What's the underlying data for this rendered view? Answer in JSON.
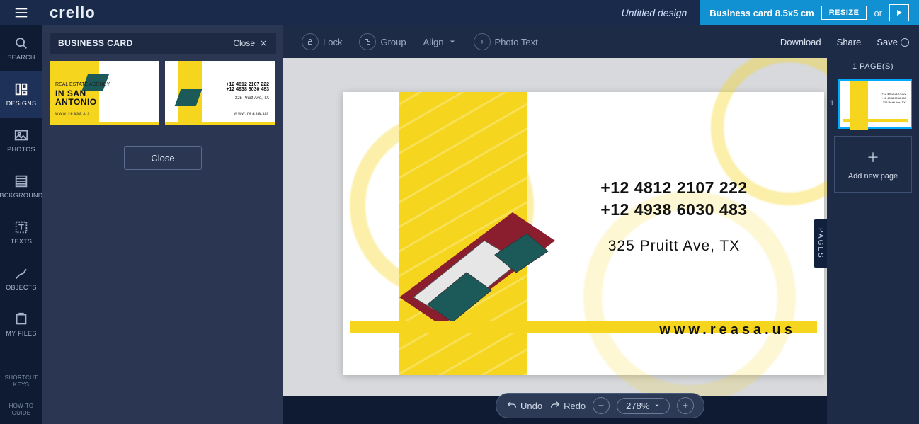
{
  "topbar": {
    "logo": "crello",
    "design_name": "Untitled design",
    "card_type": "Business card 8.5x5 cm",
    "resize": "RESIZE",
    "or": "or"
  },
  "rail": {
    "search": "SEARCH",
    "designs": "DESIGNS",
    "photos": "PHOTOS",
    "background": "BCKGROUND",
    "texts": "TEXTS",
    "objects": "OBJECTS",
    "myfiles": "MY FILES",
    "shortcut": "SHORTCUT KEYS",
    "howto": "HOW-TO GUIDE"
  },
  "sidepanel": {
    "title": "BUSINESS CARD",
    "close": "Close",
    "close_btn": "Close",
    "thumb1": {
      "line1": "REAL ESTATE AGENCY",
      "line2": "IN SAN",
      "line3": "ANTONIO",
      "site": "www.reasa.us"
    },
    "thumb2": {
      "phone1": "+12 4812 2107 222",
      "phone2": "+12 4938 6030 483",
      "addr": "325 Pruitt Ave, TX",
      "site": "www.reasa.us"
    }
  },
  "editorbar": {
    "lock": "Lock",
    "group": "Group",
    "align": "Align",
    "phototext": "Photo Text",
    "download": "Download",
    "share": "Share",
    "save": "Save"
  },
  "card": {
    "phone1": "+12 4812 2107 222",
    "phone2": "+12 4938 6030 483",
    "address": "325 Pruitt Ave, TX",
    "website": "www.reasa.us"
  },
  "zoombar": {
    "undo": "Undo",
    "redo": "Redo",
    "zoom": "278%"
  },
  "pages": {
    "head": "1 PAGE(S)",
    "add": "Add new page",
    "tab": "PAGES"
  }
}
